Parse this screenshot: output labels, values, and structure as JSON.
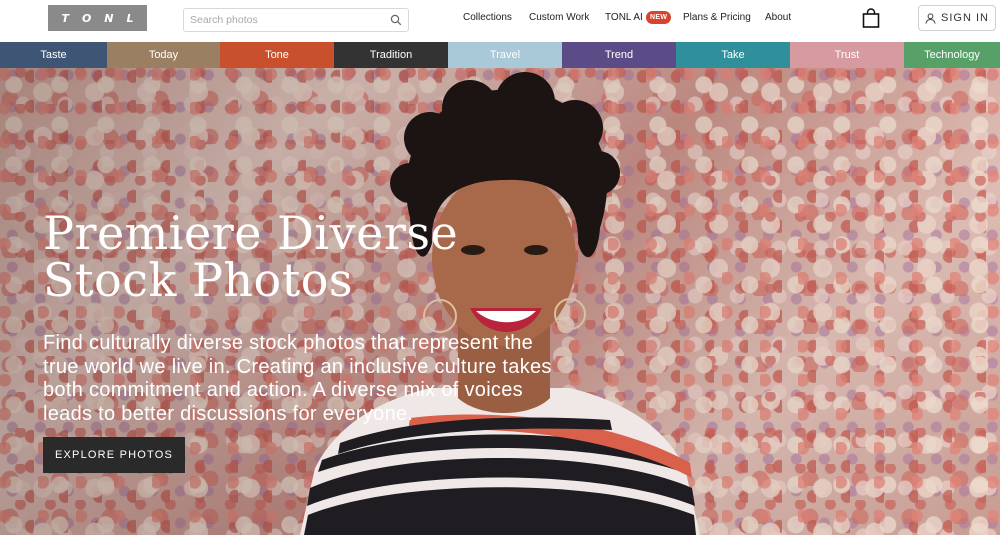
{
  "header": {
    "logo_text": "TONL",
    "search": {
      "placeholder": "Search photos",
      "value": "",
      "icon": "search-icon"
    },
    "nav": [
      {
        "label": "Collections"
      },
      {
        "label": "Custom Work"
      },
      {
        "label": "TONL AI",
        "badge": "NEW"
      },
      {
        "label": "Plans & Pricing"
      },
      {
        "label": "About"
      }
    ],
    "cart_icon": "shopping-bag-icon",
    "sign_in_label": "SIGN IN",
    "sign_in_icon": "user-icon"
  },
  "categories": [
    {
      "label": "Taste",
      "color": "#3f5575"
    },
    {
      "label": "Today",
      "color": "#9a7f62"
    },
    {
      "label": "Tone",
      "color": "#c9502d"
    },
    {
      "label": "Tradition",
      "color": "#333333"
    },
    {
      "label": "Travel",
      "color": "#a9c8d8"
    },
    {
      "label": "Trend",
      "color": "#5b4b86"
    },
    {
      "label": "Take",
      "color": "#2f8f9b"
    },
    {
      "label": "Trust",
      "color": "#d79aa0"
    },
    {
      "label": "Technology",
      "color": "#57a067"
    }
  ],
  "hero": {
    "title_line1": "Premiere Diverse",
    "title_line2": "Stock Photos",
    "description": "Find culturally diverse stock photos that represent the true world we live in. Creating an inclusive culture takes both commitment and action. A diverse mix of voices leads to better discussions for everyone.",
    "cta_label": "EXPLORE PHOTOS"
  }
}
